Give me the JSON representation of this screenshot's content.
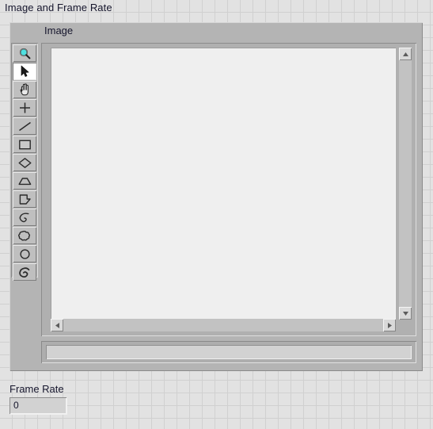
{
  "panel": {
    "title": "Image and Frame Rate",
    "background_color": "#e2e2e2",
    "grid_line_color": "#d0d0d0"
  },
  "image_control": {
    "label": "Image",
    "canvas_color": "#efefef",
    "status_bar_text": "",
    "tool_palette": {
      "selected_tool": "selection-arrow",
      "tools": [
        {
          "id": "zoom",
          "label": "Zoom",
          "icon": "magnifier-icon",
          "selected": false
        },
        {
          "id": "selection-arrow",
          "label": "Selection Tool",
          "icon": "arrow-pointer-icon",
          "selected": true
        },
        {
          "id": "pan",
          "label": "Pan",
          "icon": "hand-icon",
          "selected": false
        },
        {
          "id": "point",
          "label": "Point",
          "icon": "crosshair-icon",
          "selected": false
        },
        {
          "id": "line",
          "label": "Line",
          "icon": "line-icon",
          "selected": false
        },
        {
          "id": "rectangle",
          "label": "Rectangle",
          "icon": "rectangle-icon",
          "selected": false
        },
        {
          "id": "rotated-rectangle",
          "label": "Rotated Rectangle",
          "icon": "diamond-icon",
          "selected": false
        },
        {
          "id": "oval",
          "label": "Oval",
          "icon": "arc-segment-icon",
          "selected": false
        },
        {
          "id": "polygon",
          "label": "Polygon",
          "icon": "polygon-icon",
          "selected": false
        },
        {
          "id": "freehand-line",
          "label": "Freehand Line",
          "icon": "freehand-line-icon",
          "selected": false
        },
        {
          "id": "annulus",
          "label": "Annulus",
          "icon": "cloud-region-icon",
          "selected": false
        },
        {
          "id": "freehand-region",
          "label": "Freehand Region",
          "icon": "circle-region-icon",
          "selected": false
        },
        {
          "id": "broken-line",
          "label": "Broken Line",
          "icon": "spiral-region-icon",
          "selected": false
        }
      ]
    },
    "vertical_scrollbar": {
      "up_arrow": "scroll-up-arrow-icon",
      "down_arrow": "scroll-down-arrow-icon"
    },
    "horizontal_scrollbar": {
      "left_arrow": "scroll-left-arrow-icon",
      "right_arrow": "scroll-right-arrow-icon"
    }
  },
  "frame_rate": {
    "label": "Frame Rate",
    "value": "0"
  }
}
